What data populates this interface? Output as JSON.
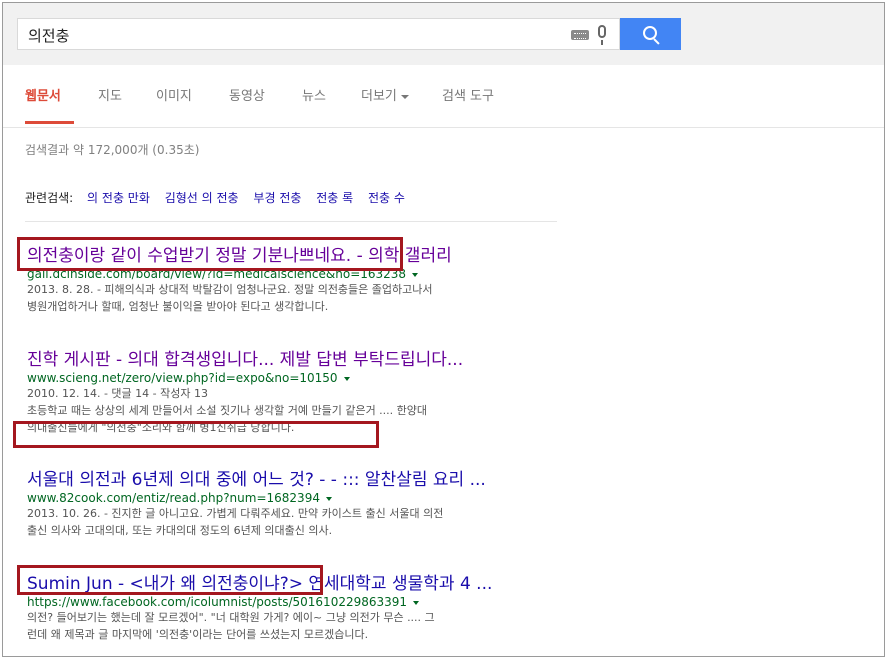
{
  "search": {
    "query": "의전충"
  },
  "tabs": [
    {
      "label": "웹문서",
      "active": true
    },
    {
      "label": "지도"
    },
    {
      "label": "이미지"
    },
    {
      "label": "동영상"
    },
    {
      "label": "뉴스"
    },
    {
      "label": "더보기"
    },
    {
      "label": "검색 도구"
    }
  ],
  "stats": "검색결과 약 172,000개 (0.35초)",
  "related": {
    "label": "관련검색:",
    "items": [
      "의 전충 만화",
      "김형선 의 전충",
      "부경 전충",
      "전충 록",
      "전충 수"
    ]
  },
  "results": [
    {
      "title": "의전충이랑 같이 수업받기 정말 기분나쁘네요. - 의학 갤러리",
      "url": "gall.dcinside.com/board/view/?id=medicalscience&no=163238",
      "snippet1": "2013. 8. 28. - 피해의식과 상대적 박탈감이 엄청나군요. 정말 의전충들은 졸업하고나서",
      "snippet2": "병원개업하거나 할때, 엄청난 불이익을 받아야 된다고 생각합니다."
    },
    {
      "title": "진학 게시판 - 의대 합격생입니다... 제발 답변 부탁드립니다...",
      "url": "www.scieng.net/zero/view.php?id=expo&no=10150",
      "snippet1": "2010. 12. 14. - 댓글 14 - 작성자 13",
      "snippet2": "초등학교 때는 상상의 세계 만들어서 소설 짓기나 생각할 거예 만들기 같은거 .... 한양대",
      "snippet3": "의대출신들에게 \"의전충\"소리와 함께 병1신취급 당합니다."
    },
    {
      "title": "서울대 의전과 6년제 의대 중에 어느 것? - - ::: 알찬살림 요리 ...",
      "url": "www.82cook.com/entiz/read.php?num=1682394",
      "snippet1": "2013. 10. 26. - 진지한 글 아니고요. 가볍게 다뤄주세요. 만약 카이스트 출신 서울대 의전",
      "snippet2": "출신 의사와 고대의대, 또는 카대의대 정도의 6년제 의대출신 의사."
    },
    {
      "title": "Sumin Jun - <내가 왜 의전충이냐?> 연세대학교 생물학과 4 ...",
      "url": "https://www.facebook.com/icolumnist/posts/501610229863391",
      "snippet1": "의전? 들어보기는 했는데 잘 모르겠어\". \"너 대학원 가게? 에이~ 그냥 의전가 무슨 .... 그",
      "snippet2": "런데 왜 제목과 글 마지막에 '의전충'이라는 단어를 쓰셨는지 모르겠습니다."
    }
  ],
  "colors": {
    "highlight": "#a4171f",
    "link": "#1a0dab",
    "visited": "#660099",
    "url": "#006621",
    "search_blue": "#4285f4"
  }
}
